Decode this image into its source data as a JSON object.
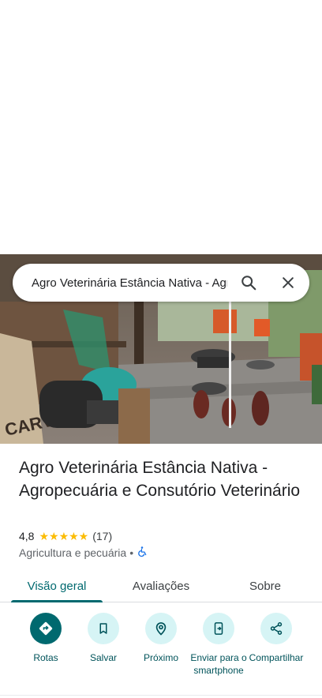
{
  "search": {
    "query": "Agro Veterinária Estância Nativa - Agro",
    "search_icon": "search-icon",
    "close_icon": "close-icon"
  },
  "place": {
    "title": "Agro Veterinária Estância Nativa - Agropecuária e Consutório Veterinário",
    "rating": "4,8",
    "stars": "★★★★★",
    "reviews": "(17)",
    "category": "Agricultura e pecuária",
    "separator": "•",
    "accessibility_icon": "wheelchair-icon"
  },
  "tabs": [
    {
      "label": "Visão geral",
      "active": true
    },
    {
      "label": "Avaliações",
      "active": false
    },
    {
      "label": "Sobre",
      "active": false
    }
  ],
  "actions": [
    {
      "label": "Rotas",
      "icon": "directions-icon"
    },
    {
      "label": "Salvar",
      "icon": "bookmark-icon"
    },
    {
      "label": "Próximo",
      "icon": "nearby-icon"
    },
    {
      "label": "Enviar para o smartphone",
      "icon": "send-to-phone-icon"
    },
    {
      "label": "Compartilhar",
      "icon": "share-icon"
    }
  ],
  "colors": {
    "accent": "#00696f",
    "accent_light": "#d6f4f5",
    "star": "#fbbc04",
    "accessibility": "#1a73e8"
  }
}
